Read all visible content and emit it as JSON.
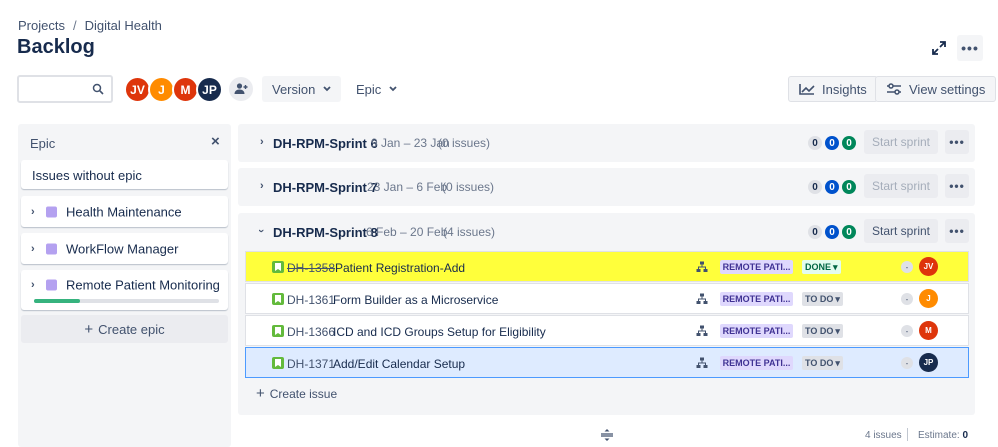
{
  "breadcrumb": {
    "root": "Projects",
    "separator": "/",
    "project": "Digital Health"
  },
  "page_title": "Backlog",
  "toolbar": {
    "search_placeholder": "",
    "avatars": [
      {
        "initials": "JV",
        "color": "#de350b"
      },
      {
        "initials": "J",
        "color": "#ff8b00"
      },
      {
        "initials": "M",
        "color": "#de350b"
      },
      {
        "initials": "JP",
        "color": "#172b4d"
      }
    ],
    "version_label": "Version",
    "epic_label": "Epic",
    "insights_label": "Insights",
    "view_settings_label": "View settings"
  },
  "epic_panel": {
    "title": "Epic",
    "close": "×",
    "issues_without_epic": "Issues without epic",
    "epics": [
      {
        "name": "Health Maintenance",
        "color": "#b4a1f0"
      },
      {
        "name": "WorkFlow Manager",
        "color": "#b4a1f0"
      },
      {
        "name": "Remote Patient Monitoring",
        "color": "#b4a1f0",
        "progress": 0.25
      }
    ],
    "create_epic": "Create epic"
  },
  "sprints": [
    {
      "name": "DH-RPM-Sprint 6",
      "dates": "9 Jan – 23 Jan",
      "issue_count": "(0 issues)",
      "counts": [
        "0",
        "0",
        "0"
      ],
      "start_label": "Start sprint",
      "expanded": false
    },
    {
      "name": "DH-RPM-Sprint 7",
      "dates": "23 Jan – 6 Feb",
      "issue_count": "(0 issues)",
      "counts": [
        "0",
        "0",
        "0"
      ],
      "start_label": "Start sprint",
      "expanded": false
    },
    {
      "name": "DH-RPM-Sprint 8",
      "dates": "6 Feb – 20 Feb",
      "issue_count": "(4 issues)",
      "counts": [
        "0",
        "0",
        "0"
      ],
      "start_label": "Start sprint",
      "expanded": true,
      "issues": [
        {
          "key": "DH-1358",
          "summary": "Patient Registration-Add",
          "epic": "REMOTE PATI...",
          "status": "DONE",
          "estimate": "-",
          "assignee": "JV",
          "assignee_color": "#de350b",
          "done": true
        },
        {
          "key": "DH-1361",
          "summary": "Form Builder as a Microservice",
          "epic": "REMOTE PATI...",
          "status": "TO DO",
          "estimate": "-",
          "assignee": "J",
          "assignee_color": "#ff8b00",
          "done": false
        },
        {
          "key": "DH-1366",
          "summary": "ICD and ICD Groups Setup for Eligibility",
          "epic": "REMOTE PATI...",
          "status": "TO DO",
          "estimate": "-",
          "assignee": "M",
          "assignee_color": "#de350b",
          "done": false
        },
        {
          "key": "DH-1371",
          "summary": "Add/Edit Calendar Setup",
          "epic": "REMOTE PATI...",
          "status": "TO DO",
          "estimate": "-",
          "assignee": "JP",
          "assignee_color": "#172b4d",
          "done": false
        }
      ],
      "create_issue": "Create issue"
    }
  ],
  "footer": {
    "issue_count": "4 issues",
    "estimate_label": "Estimate:",
    "estimate_value": "0"
  }
}
